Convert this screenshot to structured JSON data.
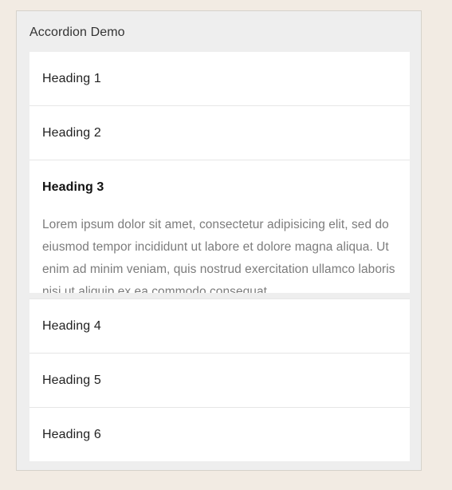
{
  "page": {
    "background_color": "#f2ebe3",
    "container_background_color": "#eeeeee",
    "container_border_color": "#d6d2cb",
    "panel_background_color": "#ffffff",
    "divider_color": "#e6e6e6",
    "heading_text_color": "#222222",
    "body_text_color": "#7c7c7c"
  },
  "demo": {
    "title": "Accordion Demo"
  },
  "accordion": {
    "items": [
      {
        "heading": "Heading 1",
        "expanded": false,
        "content": ""
      },
      {
        "heading": "Heading 2",
        "expanded": false,
        "content": ""
      },
      {
        "heading": "Heading 3",
        "expanded": true,
        "content": "Lorem ipsum dolor sit amet, consectetur adipisicing elit, sed do eiusmod tempor incididunt ut labore et dolore magna aliqua. Ut enim ad minim veniam, quis nostrud exercitation ullamco laboris nisi ut aliquip ex ea commodo consequat."
      },
      {
        "heading": "Heading 4",
        "expanded": false,
        "content": ""
      },
      {
        "heading": "Heading 5",
        "expanded": false,
        "content": ""
      },
      {
        "heading": "Heading 6",
        "expanded": false,
        "content": ""
      }
    ]
  }
}
